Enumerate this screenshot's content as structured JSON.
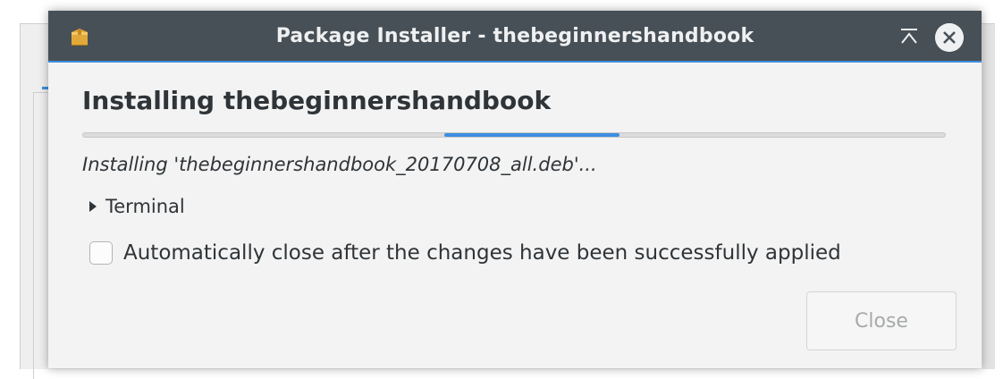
{
  "window": {
    "title": "Package Installer - thebeginnershandbook",
    "icon": "package-icon",
    "controls": [
      "keep-above-icon",
      "close-icon"
    ]
  },
  "content": {
    "heading": "Installing thebeginnershandbook",
    "progress": {
      "indeterminate": true
    },
    "status": "Installing 'thebeginnershandbook_20170708_all.deb'...",
    "terminal_label": "Terminal",
    "terminal_expanded": false,
    "auto_close_label": "Automatically close after the changes have been successfully applied",
    "auto_close_checked": false
  },
  "buttons": {
    "close_label": "Close",
    "close_enabled": false
  },
  "colors": {
    "titlebar": "#475057",
    "accent": "#3d8ee0",
    "dialog_bg": "#f3f3f3",
    "text": "#2f3438",
    "disabled_text": "#a7a9ab"
  }
}
